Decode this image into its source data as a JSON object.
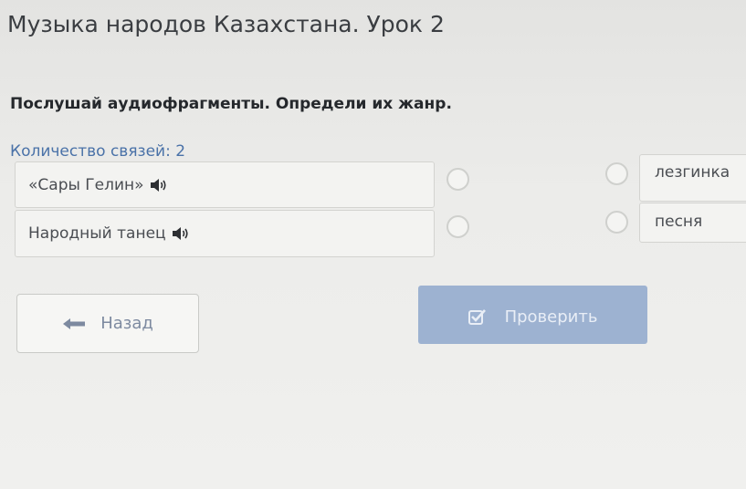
{
  "header": {
    "title": "Музыка народов Казахстана. Урок 2"
  },
  "task": {
    "instruction": "Послушай аудиофрагменты. Определи их жанр.",
    "connections_label": "Количество связей: 2"
  },
  "left_items": [
    {
      "label": "«Сары Гелин»",
      "icon": "speaker-icon"
    },
    {
      "label": "Народный танец",
      "icon": "speaker-icon"
    }
  ],
  "right_items": [
    {
      "label": "лезгинка"
    },
    {
      "label": "песня"
    }
  ],
  "buttons": {
    "back_label": "Назад",
    "back_icon": "arrow-left-icon",
    "check_label": "Проверить",
    "check_icon": "checkbox-icon"
  },
  "colors": {
    "accent": "#4a72a8",
    "check_button_bg": "#9db2d1"
  }
}
